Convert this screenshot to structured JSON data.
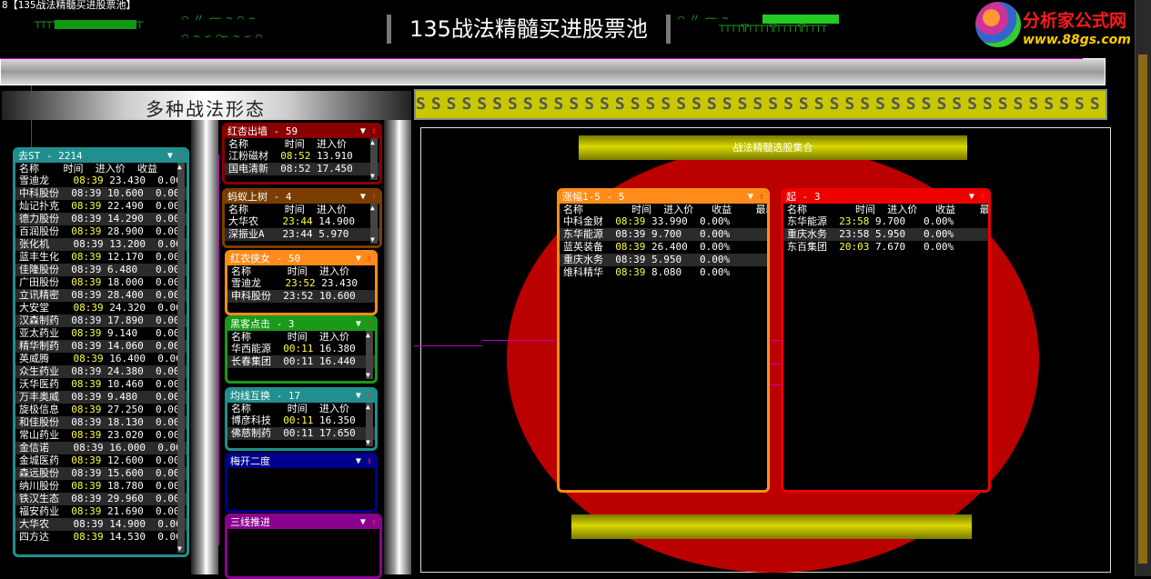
{
  "window": {
    "title": "8【135战法精髓买进股票池】"
  },
  "header": {
    "title": "135战法精髓买进股票池",
    "left_section": "多种战法形态",
    "collection_title": "战法精髓选股集合",
    "s_banner": "SSSSSSSSSSSSSSSSSSSSSSSSSSSSSSSSSSSSSSSSSSSSSSSSSSSS"
  },
  "logo": {
    "name": "分析家公式网",
    "url": "www.88gs.com"
  },
  "columns": {
    "name": "名称",
    "time": "时间",
    "price": "进入价",
    "gain": "收益",
    "latest": "最新"
  },
  "colors": {
    "teal": "#1f8f8f",
    "maroon": "#8a0000",
    "brown": "#7a3e00",
    "orange": "#ff8c1a",
    "green": "#1a9a1a",
    "navy": "#00008c",
    "purple": "#8c0090",
    "red": "#ee0000"
  },
  "panels": {
    "quchu": {
      "title": "去ST - 2214",
      "rows": [
        [
          "雪迪龙",
          "08:39",
          "23.430",
          "0.00"
        ],
        [
          "中科股份",
          "08:39",
          "10.600",
          "0.00"
        ],
        [
          "灿记扑克",
          "08:39",
          "22.490",
          "0.00"
        ],
        [
          "德力股份",
          "08:39",
          "14.290",
          "0.00"
        ],
        [
          "百润股份",
          "08:39",
          "28.900",
          "0.00"
        ],
        [
          "张化机",
          "08:39",
          "13.200",
          "0.00"
        ],
        [
          "蓝丰生化",
          "08:39",
          "12.170",
          "0.00"
        ],
        [
          "佳隆股份",
          "08:39",
          "6.480",
          "0.00"
        ],
        [
          "广田股份",
          "08:39",
          "18.000",
          "0.00"
        ],
        [
          "立讯精密",
          "08:39",
          "28.400",
          "0.00"
        ],
        [
          "大安堂",
          "08:39",
          "24.320",
          "0.00"
        ],
        [
          "汉森制药",
          "08:39",
          "17.890",
          "0.00"
        ],
        [
          "亚太药业",
          "08:39",
          "9.140",
          "0.00"
        ],
        [
          "精华制药",
          "08:39",
          "14.060",
          "0.00"
        ],
        [
          "英威腾",
          "08:39",
          "16.400",
          "0.00"
        ],
        [
          "众生药业",
          "08:39",
          "24.380",
          "0.00"
        ],
        [
          "沃华医药",
          "08:39",
          "10.460",
          "0.00"
        ],
        [
          "万丰奥威",
          "08:39",
          "9.480",
          "0.00"
        ],
        [
          "旋极信息",
          "08:39",
          "27.250",
          "0.00"
        ],
        [
          "和佳股份",
          "08:39",
          "18.130",
          "0.00"
        ],
        [
          "常山药业",
          "08:39",
          "23.020",
          "0.00"
        ],
        [
          "金信诺",
          "08:39",
          "16.000",
          "0.00"
        ],
        [
          "金城医药",
          "08:39",
          "12.600",
          "0.00"
        ],
        [
          "森远股份",
          "08:39",
          "15.600",
          "0.00"
        ],
        [
          "纳川股份",
          "08:39",
          "18.780",
          "0.00"
        ],
        [
          "铁汉生态",
          "08:39",
          "29.960",
          "0.00"
        ],
        [
          "福安药业",
          "08:39",
          "21.690",
          "0.00"
        ],
        [
          "大华农",
          "08:39",
          "14.900",
          "0.00"
        ],
        [
          "四方达",
          "08:39",
          "14.530",
          "0.00"
        ]
      ]
    },
    "hongxing": {
      "title": "红杏出墙 - 59",
      "rows": [
        [
          "江粉磁材",
          "08:52",
          "13.910"
        ],
        [
          "国电清新",
          "08:52",
          "17.450"
        ]
      ]
    },
    "mayi": {
      "title": "蚂蚁上树 - 4",
      "rows": [
        [
          "大华农",
          "23:44",
          "14.900"
        ],
        [
          "深振业A",
          "23:44",
          "5.970"
        ]
      ]
    },
    "hongyi": {
      "title": "红衣侠女 - 50",
      "rows": [
        [
          "雪迪龙",
          "23:52",
          "23.430"
        ],
        [
          "申科股份",
          "23:52",
          "10.600"
        ]
      ]
    },
    "heike": {
      "title": "黑客点击 - 3",
      "rows": [
        [
          "华西能源",
          "00:11",
          "16.380"
        ],
        [
          "长春集团",
          "00:11",
          "16.440"
        ]
      ]
    },
    "junxian": {
      "title": "均线互换 - 17",
      "rows": [
        [
          "博彦科技",
          "00:11",
          "16.350"
        ],
        [
          "佛慈制药",
          "00:11",
          "17.650"
        ]
      ]
    },
    "meikai": {
      "title": "梅开二度"
    },
    "sanxian": {
      "title": "三线推进"
    },
    "zhangfu": {
      "title": "涨幅1-5 - 5",
      "rows": [
        [
          "中科金财",
          "08:39",
          "33.990",
          "0.00%"
        ],
        [
          "东华能源",
          "08:39",
          "9.700",
          "0.00%"
        ],
        [
          "蓝英装备",
          "08:39",
          "26.400",
          "0.00%"
        ],
        [
          "重庆水务",
          "08:39",
          "5.950",
          "0.00%"
        ],
        [
          "维科精华",
          "08:39",
          "8.080",
          "0.00%"
        ]
      ]
    },
    "qi": {
      "title": "起 - 3",
      "rows": [
        [
          "东华能源",
          "23:58",
          "9.700",
          "0.00%"
        ],
        [
          "重庆水务",
          "23:58",
          "5.950",
          "0.00%"
        ],
        [
          "东百集团",
          "20:03",
          "7.670",
          "0.00%"
        ]
      ]
    }
  }
}
